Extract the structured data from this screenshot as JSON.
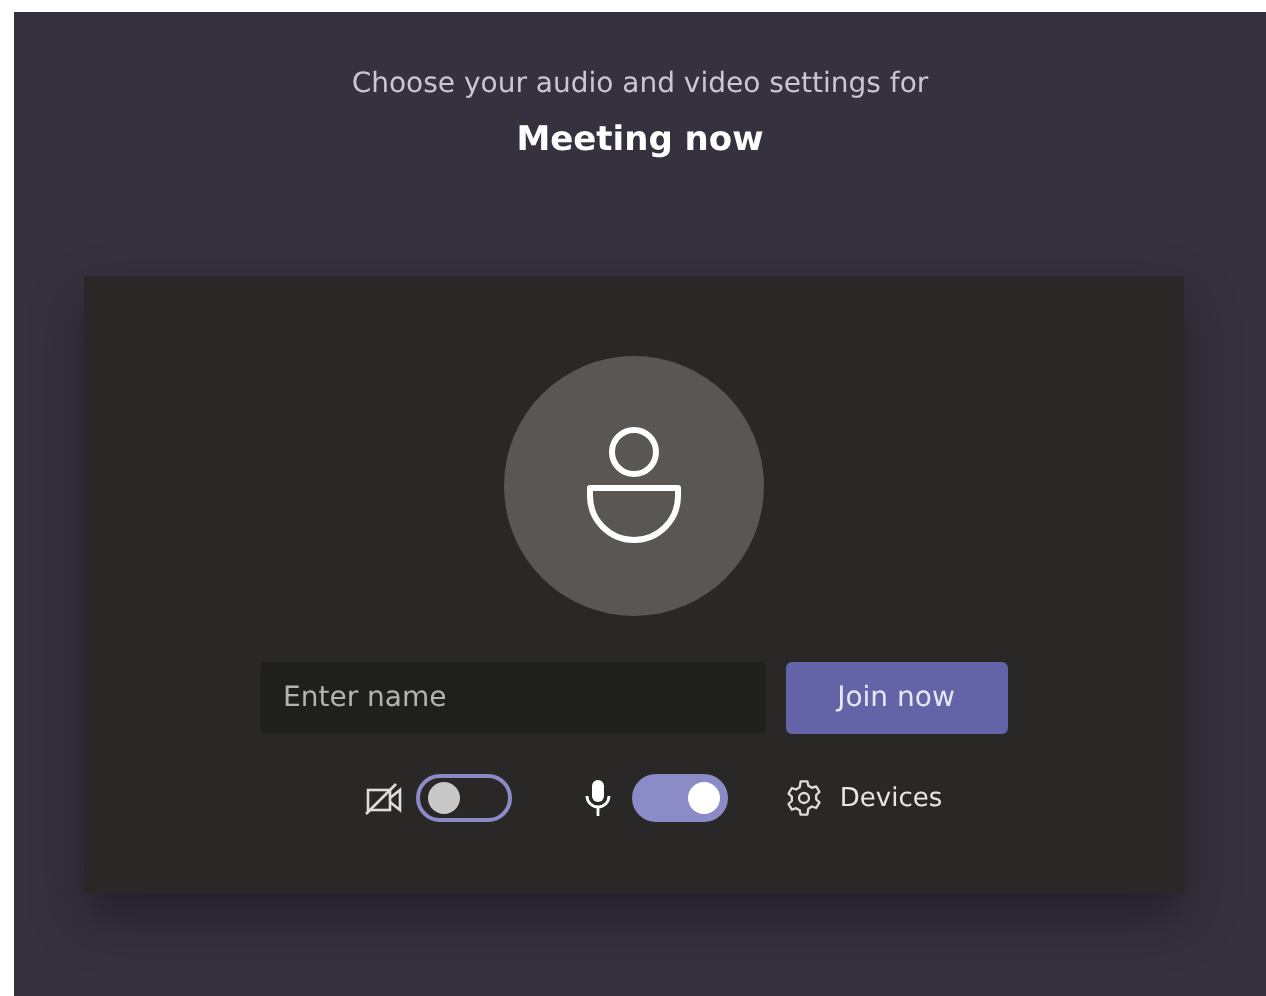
{
  "header": {
    "subtitle": "Choose your audio and video settings for",
    "title": "Meeting now"
  },
  "name_field": {
    "placeholder": "Enter name"
  },
  "join_button": {
    "label": "Join now"
  },
  "camera": {
    "on": false
  },
  "microphone": {
    "on": true
  },
  "devices": {
    "label": "Devices"
  }
}
